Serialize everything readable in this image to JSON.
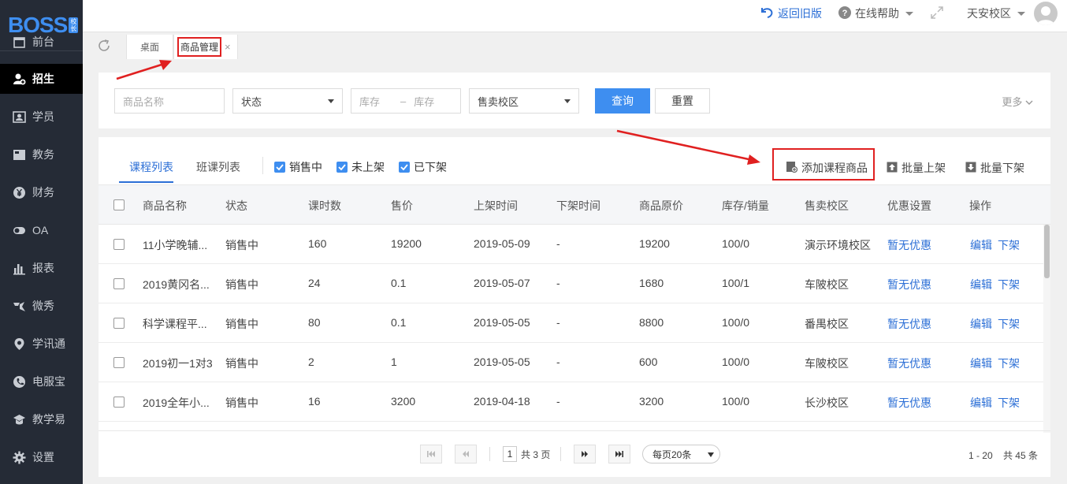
{
  "brand": {
    "logo": "BOSS",
    "badge": "校长"
  },
  "sidebar": {
    "items": [
      {
        "label": "前台",
        "icon": "calendar-icon",
        "active": false
      },
      {
        "label": "招生",
        "icon": "user-add-icon",
        "active": true
      },
      {
        "label": "学员",
        "icon": "id-card-icon",
        "active": false
      },
      {
        "label": "教务",
        "icon": "book-icon",
        "active": false
      },
      {
        "label": "财务",
        "icon": "yen-icon",
        "active": false
      },
      {
        "label": "OA",
        "icon": "toggle-icon",
        "active": false
      },
      {
        "label": "报表",
        "icon": "bar-chart-icon",
        "active": false
      },
      {
        "label": "微秀",
        "icon": "weixiu-icon",
        "active": false
      },
      {
        "label": "学讯通",
        "icon": "location-pin-icon",
        "active": false
      },
      {
        "label": "电服宝",
        "icon": "phone-icon",
        "active": false
      },
      {
        "label": "教学易",
        "icon": "teach-icon",
        "active": false
      },
      {
        "label": "设置",
        "icon": "gear-icon",
        "active": false
      }
    ]
  },
  "header": {
    "back_old": "返回旧版",
    "help": "在线帮助",
    "campus": "天安校区"
  },
  "tabs": {
    "home": "桌面",
    "current": "商品管理",
    "close": "×"
  },
  "filter": {
    "name_placeholder": "商品名称",
    "status": "状态",
    "stock_from": "库存",
    "stock_dash": "–",
    "stock_to": "库存",
    "campus": "售卖校区",
    "query": "查询",
    "reset": "重置",
    "more": "更多"
  },
  "list": {
    "tabs": [
      "课程列表",
      "班课列表"
    ],
    "filters": [
      "销售中",
      "未上架",
      "已下架"
    ],
    "actions": {
      "add": "添加课程商品",
      "batch_on": "批量上架",
      "batch_off": "批量下架"
    },
    "columns": [
      "商品名称",
      "状态",
      "课时数",
      "售价",
      "上架时间",
      "下架时间",
      "商品原价",
      "库存/销量",
      "售卖校区",
      "优惠设置",
      "操作"
    ],
    "rows": [
      [
        "11小学晚辅...",
        "销售中",
        "160",
        "19200",
        "2019-05-09",
        "-",
        "19200",
        "100/0",
        "演示环境校区",
        "暂无优惠"
      ],
      [
        "2019黄冈名...",
        "销售中",
        "24",
        "0.1",
        "2019-05-07",
        "-",
        "1680",
        "100/1",
        "车陂校区",
        "暂无优惠"
      ],
      [
        "科学课程平...",
        "销售中",
        "80",
        "0.1",
        "2019-05-05",
        "-",
        "8800",
        "100/0",
        "番禺校区",
        "暂无优惠"
      ],
      [
        "2019初一1对3",
        "销售中",
        "2",
        "1",
        "2019-05-05",
        "-",
        "600",
        "100/0",
        "车陂校区",
        "暂无优惠"
      ],
      [
        "2019全年小...",
        "销售中",
        "16",
        "3200",
        "2019-04-18",
        "-",
        "3200",
        "100/0",
        "长沙校区",
        "暂无优惠"
      ]
    ],
    "op_edit": "编辑",
    "op_off": "下架"
  },
  "pagination": {
    "page": "1",
    "total_pages": "共 3 页",
    "page_size": "每页20条",
    "range": "1 - 20",
    "total": "共 45 条"
  },
  "colors": {
    "primary": "#3e8ef0",
    "link": "#2c6fd6",
    "sidebar": "#252b36",
    "annotation": "#e02020"
  }
}
